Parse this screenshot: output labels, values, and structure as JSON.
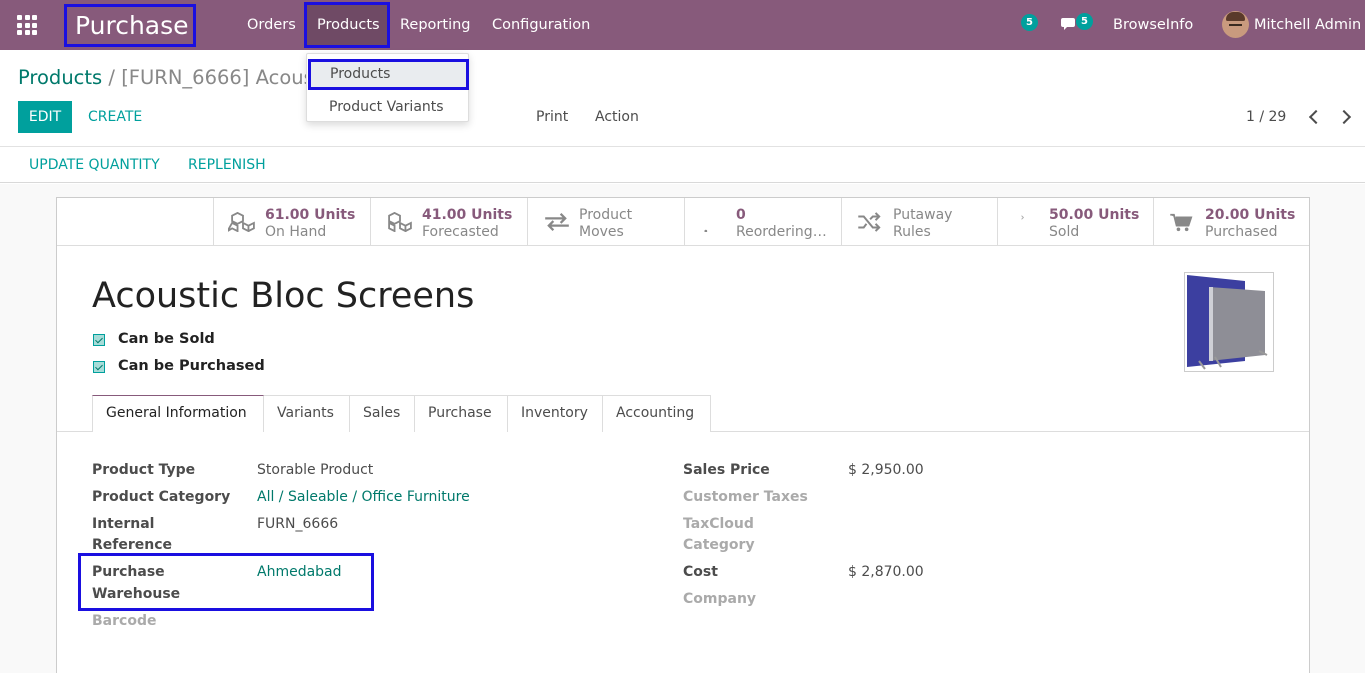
{
  "navbar": {
    "app_name": "Purchase",
    "menu": [
      "Orders",
      "Products",
      "Reporting",
      "Configuration"
    ],
    "activity_count": "5",
    "message_count": "5",
    "company": "BrowseInfo",
    "user": "Mitchell Admin",
    "icons": {
      "apps": "apps-grid-icon",
      "chat": "chat-icon",
      "avatar": "user-avatar"
    }
  },
  "dropdown": {
    "items": [
      "Products",
      "Product Variants"
    ]
  },
  "breadcrumb": {
    "parent": "Products",
    "separator": "/",
    "current": "[FURN_6666] Acoustic Bloc Screens"
  },
  "control_panel": {
    "edit": "EDIT",
    "create": "CREATE",
    "print": "Print",
    "action": "Action",
    "pager": "1 / 29"
  },
  "statusbar": {
    "update_quantity": "UPDATE QUANTITY",
    "replenish": "REPLENISH"
  },
  "smart_buttons": [
    {
      "value": "61.00 Units",
      "label": "On Hand",
      "icon": "cubes-icon"
    },
    {
      "value": "41.00 Units",
      "label": "Forecasted",
      "icon": "cubes-icon"
    },
    {
      "value": "Product",
      "label": "Moves",
      "icon": "exchange-icon"
    },
    {
      "value": "0",
      "label": "Reordering…",
      "icon": "refresh-icon"
    },
    {
      "value": "Putaway",
      "label": "Rules",
      "icon": "random-icon"
    },
    {
      "value": "50.00 Units",
      "label": "Sold",
      "icon": "signal-icon"
    },
    {
      "value": "20.00 Units",
      "label": "Purchased",
      "icon": "cart-icon"
    }
  ],
  "product": {
    "name": "Acoustic Bloc Screens",
    "can_be_sold": "Can be Sold",
    "can_be_purchased": "Can be Purchased"
  },
  "tabs": [
    "General Information",
    "Variants",
    "Sales",
    "Purchase",
    "Inventory",
    "Accounting"
  ],
  "fields_left": {
    "product_type_label": "Product Type",
    "product_type": "Storable Product",
    "product_category_label": "Product Category",
    "product_category": "All / Saleable / Office Furniture",
    "internal_reference_label_1": "Internal",
    "internal_reference_label_2": "Reference",
    "internal_reference": "FURN_6666",
    "purchase_warehouse_label_1": "Purchase",
    "purchase_warehouse_label_2": "Warehouse",
    "purchase_warehouse": "Ahmedabad",
    "barcode_label": "Barcode"
  },
  "fields_right": {
    "sales_price_label": "Sales Price",
    "sales_price": "$ 2,950.00",
    "customer_taxes_label": "Customer Taxes",
    "taxcloud_label_1": "TaxCloud",
    "taxcloud_label_2": "Category",
    "cost_label": "Cost",
    "cost": "$ 2,870.00",
    "company_label": "Company"
  }
}
